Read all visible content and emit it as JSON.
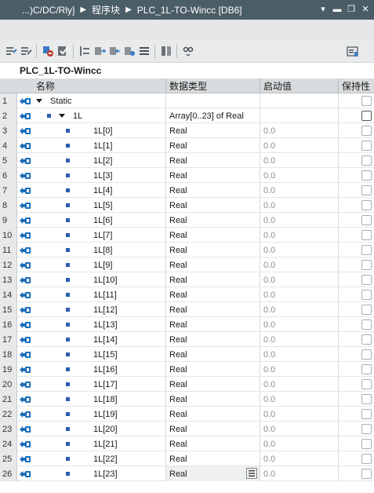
{
  "title_bar": {
    "path": "...)C/DC/Rly]",
    "separator": "▶",
    "section": "程序块",
    "block": "PLC_1L-TO-Wincc [DB6]",
    "controls": [
      "▾",
      "▬",
      "❐",
      "✕"
    ]
  },
  "toolbar": {
    "icons": [
      "keep-actual-values-icon",
      "snapshot-icon",
      "load-start-values-icon",
      "monitor-icon",
      "expand-icon",
      "insert-row-icon",
      "add-row-icon",
      "move-icon",
      "list-icon",
      "reset-icon",
      "glasses-icon",
      "overview-icon"
    ]
  },
  "db_title": "PLC_1L-TO-Wincc",
  "columns": {
    "name": "名称",
    "datatype": "数据类型",
    "start_value": "启动值",
    "retain": "保持性"
  },
  "rows": [
    {
      "num": "1",
      "name": "Static",
      "type": "",
      "start": "",
      "level": 0,
      "expand": true,
      "bullet": false
    },
    {
      "num": "2",
      "name": "1L",
      "type": "Array[0..23] of Real",
      "start": "",
      "level": 1,
      "expand": true,
      "bullet": true
    },
    {
      "num": "3",
      "name": "1L[0]",
      "type": "Real",
      "start": "0.0",
      "level": 2
    },
    {
      "num": "4",
      "name": "1L[1]",
      "type": "Real",
      "start": "0.0",
      "level": 2
    },
    {
      "num": "5",
      "name": "1L[2]",
      "type": "Real",
      "start": "0.0",
      "level": 2
    },
    {
      "num": "6",
      "name": "1L[3]",
      "type": "Real",
      "start": "0.0",
      "level": 2
    },
    {
      "num": "7",
      "name": "1L[4]",
      "type": "Real",
      "start": "0.0",
      "level": 2
    },
    {
      "num": "8",
      "name": "1L[5]",
      "type": "Real",
      "start": "0.0",
      "level": 2
    },
    {
      "num": "9",
      "name": "1L[6]",
      "type": "Real",
      "start": "0.0",
      "level": 2
    },
    {
      "num": "10",
      "name": "1L[7]",
      "type": "Real",
      "start": "0.0",
      "level": 2
    },
    {
      "num": "11",
      "name": "1L[8]",
      "type": "Real",
      "start": "0.0",
      "level": 2
    },
    {
      "num": "12",
      "name": "1L[9]",
      "type": "Real",
      "start": "0.0",
      "level": 2
    },
    {
      "num": "13",
      "name": "1L[10]",
      "type": "Real",
      "start": "0.0",
      "level": 2
    },
    {
      "num": "14",
      "name": "1L[11]",
      "type": "Real",
      "start": "0.0",
      "level": 2
    },
    {
      "num": "15",
      "name": "1L[12]",
      "type": "Real",
      "start": "0.0",
      "level": 2
    },
    {
      "num": "16",
      "name": "1L[13]",
      "type": "Real",
      "start": "0.0",
      "level": 2
    },
    {
      "num": "17",
      "name": "1L[14]",
      "type": "Real",
      "start": "0.0",
      "level": 2
    },
    {
      "num": "18",
      "name": "1L[15]",
      "type": "Real",
      "start": "0.0",
      "level": 2
    },
    {
      "num": "19",
      "name": "1L[16]",
      "type": "Real",
      "start": "0.0",
      "level": 2
    },
    {
      "num": "20",
      "name": "1L[17]",
      "type": "Real",
      "start": "0.0",
      "level": 2
    },
    {
      "num": "21",
      "name": "1L[18]",
      "type": "Real",
      "start": "0.0",
      "level": 2
    },
    {
      "num": "22",
      "name": "1L[19]",
      "type": "Real",
      "start": "0.0",
      "level": 2
    },
    {
      "num": "23",
      "name": "1L[20]",
      "type": "Real",
      "start": "0.0",
      "level": 2
    },
    {
      "num": "24",
      "name": "1L[21]",
      "type": "Real",
      "start": "0.0",
      "level": 2
    },
    {
      "num": "25",
      "name": "1L[22]",
      "type": "Real",
      "start": "0.0",
      "level": 2
    },
    {
      "num": "26",
      "name": "1L[23]",
      "type": "Real",
      "start": "0.0",
      "level": 2,
      "selected": true
    }
  ],
  "colors": {
    "titlebar": "#4b5d66",
    "header": "#d9dcde",
    "bullet": "#2a5db0",
    "interface_icon": "#1d6fb8"
  }
}
